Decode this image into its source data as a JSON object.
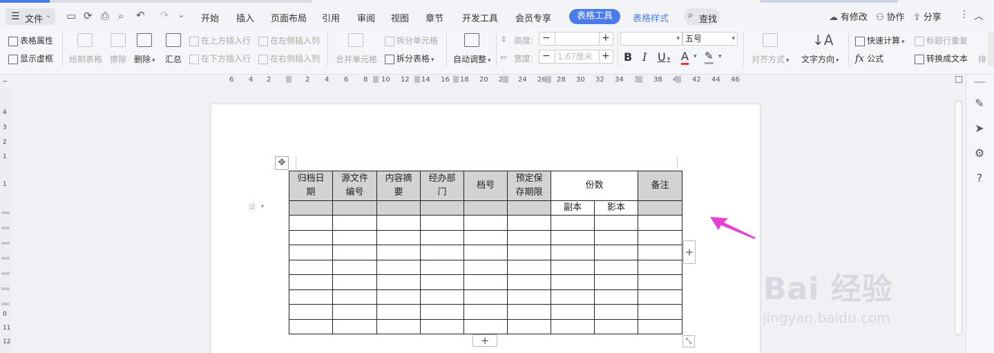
{
  "tabs": [
    "开始",
    "插入",
    "页面布局",
    "引用",
    "审阅",
    "视图",
    "章节",
    "开发工具",
    "会员专享"
  ],
  "tab_active": "表格工具",
  "tab_style": "表格样式",
  "file_menu": "文件",
  "search_label": "查找",
  "right_actions": {
    "modified": "有修改",
    "collab": "协作",
    "share": "分享"
  },
  "ribbon": {
    "table_props": "表格属性",
    "show_gridlines": "显示虚框",
    "draw_table": "绘制表格",
    "erase": "擦除",
    "delete": "删除",
    "summary": "汇总",
    "insert_above": "在上方插入行",
    "insert_below": "在下方插入行",
    "insert_left": "在左侧插入列",
    "insert_right": "在右侧插入列",
    "merge_cells": "合并单元格",
    "split_cells": "拆分单元格",
    "split_table": "拆分表格",
    "auto_fit": "自动调整",
    "height_label": "高度:",
    "width_label": "宽度:",
    "width_value": "1.67厘米",
    "font_size": "五号",
    "align": "对齐方式",
    "text_dir": "文字方向",
    "quick_calc": "快速计算",
    "formula": "公式",
    "repeat_header": "标题行重复",
    "to_text": "转换成文本",
    "overflow": "排"
  },
  "ruler_numbers": [
    "6",
    "4",
    "2",
    "2",
    "4",
    "6",
    "8",
    "10",
    "12",
    "14",
    "16",
    "18",
    "20",
    "22",
    "24",
    "26",
    "28",
    "30",
    "32",
    "34",
    "36",
    "38",
    "40",
    "42",
    "44",
    "46"
  ],
  "vruler_numbers": [
    "4",
    "3",
    "2",
    "1",
    "1",
    "0",
    "11",
    "12"
  ],
  "table": {
    "headers": [
      "归档日期",
      "源文件编号",
      "内容摘要",
      "经办部门",
      "档号",
      "预定保存期限",
      "份数",
      "备注"
    ],
    "header_wrap": [
      [
        "归档日",
        "期"
      ],
      [
        "源文件",
        "编号"
      ],
      [
        "内容摘",
        "要"
      ],
      [
        "经办部",
        "门"
      ],
      [
        "档号"
      ],
      [
        "预定保",
        "存期限"
      ],
      [
        "份数"
      ],
      [
        "备注"
      ]
    ],
    "sub_headers": [
      "副本",
      "影本"
    ],
    "empty_rows": 8
  },
  "watermark": {
    "logo": "Bai 经验",
    "url": "jingyan.baidu.com"
  },
  "colors": {
    "accent": "#4a7be8",
    "arrow": "#e83fd4",
    "header_fill": "#d3d3d3"
  },
  "icons": [
    "undo-icon",
    "redo-icon",
    "save-icon",
    "print-icon",
    "search-icon",
    "plus-icon",
    "move-icon",
    "pencil-icon",
    "cursor-icon",
    "settings-icon",
    "help-icon"
  ]
}
